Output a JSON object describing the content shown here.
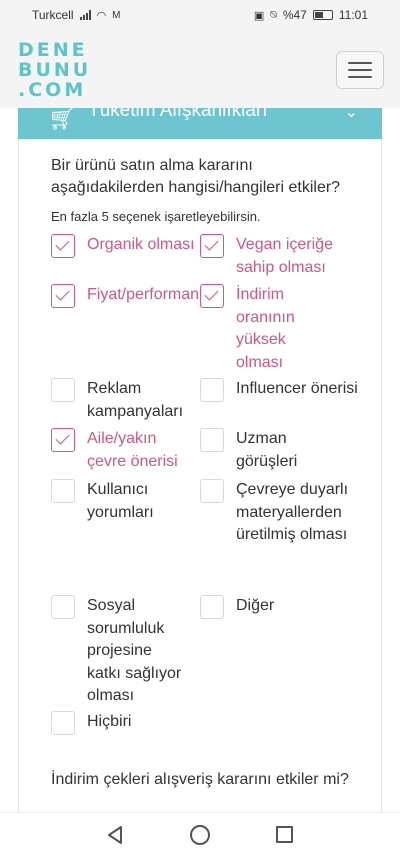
{
  "status_bar": {
    "carrier": "Turkcell",
    "battery": "%47",
    "time": "11:01"
  },
  "header": {
    "logo_lines": [
      "DENE",
      "BUNU",
      ".COM"
    ]
  },
  "section": {
    "title": "Tüketim Alışkanlıkları"
  },
  "question1": {
    "text": "Bir ürünü satın alma kararını aşağıdakilerden hangisi/hangileri etkiler?",
    "hint": "En fazla 5 seçenek işaretleyebilirsin.",
    "options": [
      {
        "label": "Organik olması",
        "checked": true
      },
      {
        "label": "Vegan içeriğe sahip olması",
        "checked": true
      },
      {
        "label": "Fiyat/performans dengesi",
        "checked": true
      },
      {
        "label": "İndirim oranının yüksek olması",
        "checked": true
      },
      {
        "label": "Reklam kampanyaları",
        "checked": false
      },
      {
        "label": "Influencer önerisi",
        "checked": false
      },
      {
        "label": "Aile/yakın çevre önerisi",
        "checked": true
      },
      {
        "label": "Uzman görüşleri",
        "checked": false
      },
      {
        "label": "Kullanıcı yorumları",
        "checked": false
      },
      {
        "label": "Çevreye duyarlı materyallerden üretilmiş olması",
        "checked": false
      },
      {
        "label": "Sosyal sorumluluk projesine katkı sağlıyor olması",
        "checked": false
      },
      {
        "label": "Diğer",
        "checked": false
      },
      {
        "label": "Hiçbiri",
        "checked": false
      }
    ]
  },
  "question2": {
    "text": "İndirim çekleri alışveriş kararını etkiler mi?"
  },
  "colors": {
    "accent": "#d5567f",
    "teal": "#6cc5cf",
    "logo": "#5bc6c8"
  },
  "icons": {
    "cart": "cart-icon",
    "chevron": "chevron-down-icon",
    "menu": "hamburger-icon"
  }
}
